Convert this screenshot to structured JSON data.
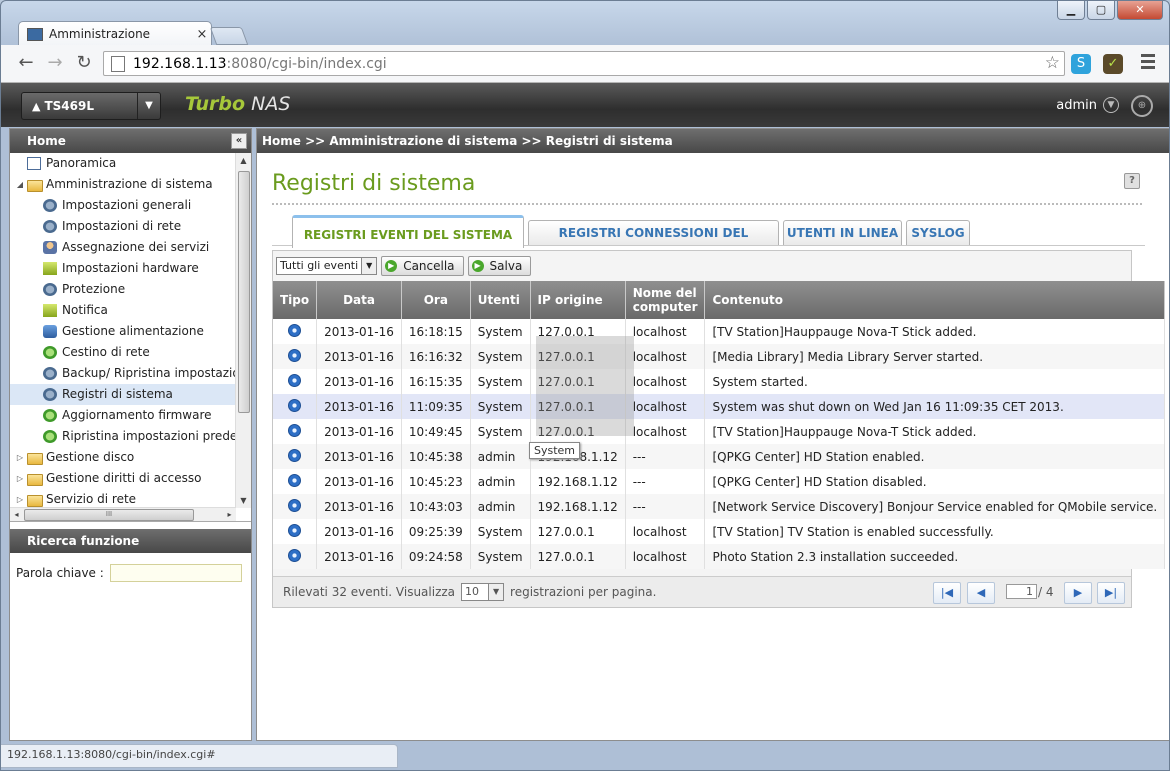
{
  "browser": {
    "tab_title": "Amministrazione",
    "tab_close": "×",
    "url_host": "192.168.1.13",
    "url_rest": ":8080/cgi-bin/index.cgi",
    "status_url": "192.168.1.13:8080/cgi-bin/index.cgi#"
  },
  "nas": {
    "device": "TS469L",
    "brand_a": "Turbo",
    "brand_b": " NAS",
    "user": "admin"
  },
  "sidebar": {
    "title": "Home",
    "items": [
      {
        "label": "Panoramica",
        "level": 1,
        "icon": "page"
      },
      {
        "label": "Amministrazione di sistema",
        "level": 1,
        "icon": "folder",
        "expanded": true
      },
      {
        "label": "Impostazioni generali",
        "level": 2,
        "icon": "gear"
      },
      {
        "label": "Impostazioni di rete",
        "level": 2,
        "icon": "gear"
      },
      {
        "label": "Assegnazione dei servizi",
        "level": 2,
        "icon": "user"
      },
      {
        "label": "Impostazioni hardware",
        "level": 2,
        "icon": "bar"
      },
      {
        "label": "Protezione",
        "level": 2,
        "icon": "gear"
      },
      {
        "label": "Notifica",
        "level": 2,
        "icon": "bar"
      },
      {
        "label": "Gestione alimentazione",
        "level": 2,
        "icon": "db"
      },
      {
        "label": "Cestino di rete",
        "level": 2,
        "icon": "green"
      },
      {
        "label": "Backup/ Ripristina impostazion",
        "level": 2,
        "icon": "gear"
      },
      {
        "label": "Registri di sistema",
        "level": 2,
        "icon": "gear",
        "selected": true
      },
      {
        "label": "Aggiornamento firmware",
        "level": 2,
        "icon": "green"
      },
      {
        "label": "Ripristina impostazioni predefir",
        "level": 2,
        "icon": "green"
      },
      {
        "label": "Gestione disco",
        "level": 1,
        "icon": "folder"
      },
      {
        "label": "Gestione diritti di accesso",
        "level": 1,
        "icon": "folder"
      },
      {
        "label": "Servizio di rete",
        "level": 1,
        "icon": "folder"
      }
    ],
    "search_title": "Ricerca funzione",
    "search_label": "Parola chiave :"
  },
  "main": {
    "breadcrumb": "Home >> Amministrazione di sistema >> Registri di sistema",
    "title": "Registri di sistema",
    "help": "?",
    "tabs": [
      {
        "label": "REGISTRI EVENTI DEL SISTEMA",
        "active": true
      },
      {
        "label": "REGISTRI CONNESSIONI DEL SISTEMA"
      },
      {
        "label": "UTENTI IN LINEA"
      },
      {
        "label": "SYSLOG"
      }
    ],
    "filter_value": "Tutti gli eventi",
    "cancel_label": "Cancella",
    "save_label": "Salva",
    "columns": [
      "Tipo",
      "Data",
      "Ora",
      "Utenti",
      "IP origine",
      "Nome del computer",
      "Contenuto"
    ],
    "rows": [
      {
        "date": "2013-01-16",
        "time": "16:18:15",
        "user": "System",
        "ip": "127.0.0.1",
        "host": "localhost",
        "content": "[TV Station]Hauppauge Nova-T Stick added."
      },
      {
        "date": "2013-01-16",
        "time": "16:16:32",
        "user": "System",
        "ip": "127.0.0.1",
        "host": "localhost",
        "content": "[Media Library] Media Library Server started."
      },
      {
        "date": "2013-01-16",
        "time": "16:15:35",
        "user": "System",
        "ip": "127.0.0.1",
        "host": "localhost",
        "content": "System started."
      },
      {
        "date": "2013-01-16",
        "time": "11:09:35",
        "user": "System",
        "ip": "127.0.0.1",
        "host": "localhost",
        "content": "System was shut down on Wed Jan 16 11:09:35 CET 2013."
      },
      {
        "date": "2013-01-16",
        "time": "10:49:45",
        "user": "System",
        "ip": "127.0.0.1",
        "host": "localhost",
        "content": "[TV Station]Hauppauge Nova-T Stick added."
      },
      {
        "date": "2013-01-16",
        "time": "10:45:38",
        "user": "admin",
        "ip": "192.168.1.12",
        "host": "---",
        "content": "[QPKG Center] HD Station enabled."
      },
      {
        "date": "2013-01-16",
        "time": "10:45:23",
        "user": "admin",
        "ip": "192.168.1.12",
        "host": "---",
        "content": "[QPKG Center] HD Station disabled."
      },
      {
        "date": "2013-01-16",
        "time": "10:43:03",
        "user": "admin",
        "ip": "192.168.1.12",
        "host": "---",
        "content": "[Network Service Discovery] Bonjour Service enabled for QMobile service."
      },
      {
        "date": "2013-01-16",
        "time": "09:25:39",
        "user": "System",
        "ip": "127.0.0.1",
        "host": "localhost",
        "content": "[TV Station] TV Station is enabled successfully."
      },
      {
        "date": "2013-01-16",
        "time": "09:24:58",
        "user": "System",
        "ip": "127.0.0.1",
        "host": "localhost",
        "content": "Photo Station 2.3 installation succeeded."
      }
    ],
    "pager": {
      "found_text": "Rilevati 32 eventi. Visualizza",
      "per_page": "10",
      "per_page_text": "registrazioni per pagina.",
      "page": "1",
      "of": "/ 4"
    },
    "tooltip": "System"
  }
}
